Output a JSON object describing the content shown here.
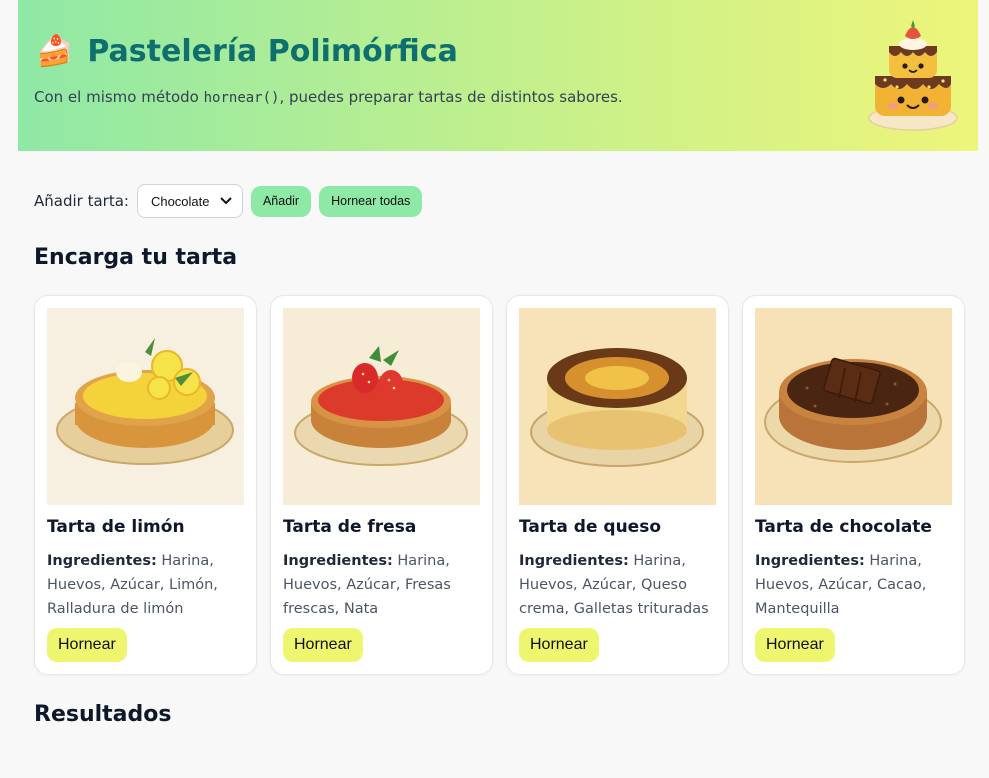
{
  "header": {
    "title": "Pastelería Polimórfica",
    "title_icon": "cake-icon",
    "subtitle_pre": "Con el mismo método ",
    "subtitle_code": "hornear()",
    "subtitle_post": ", puedes preparar tartas de distintos sabores.",
    "mascot_icon": "cake-mascot-icon"
  },
  "toolbar": {
    "add_label": "Añadir tarta:",
    "select_value": "Chocolate",
    "add_button": "Añadir",
    "bake_all_button": "Hornear todas"
  },
  "sections": {
    "order_title": "Encarga tu tarta",
    "results_title": "Resultados"
  },
  "cards": [
    {
      "title": "Tarta de limón",
      "ingredients_label": "Ingredientes:",
      "ingredients": "Harina, Huevos, Azúcar, Limón, Ralladura de limón",
      "button": "Hornear",
      "image": "lemon-tart-image"
    },
    {
      "title": "Tarta de fresa",
      "ingredients_label": "Ingredientes:",
      "ingredients": "Harina, Huevos, Azúcar, Fresas frescas, Nata",
      "button": "Hornear",
      "image": "strawberry-tart-image"
    },
    {
      "title": "Tarta de queso",
      "ingredients_label": "Ingredientes:",
      "ingredients": "Harina, Huevos, Azúcar, Queso crema, Galletas trituradas",
      "button": "Hornear",
      "image": "cheesecake-image"
    },
    {
      "title": "Tarta de chocolate",
      "ingredients_label": "Ingredientes:",
      "ingredients": "Harina, Huevos, Azúcar, Cacao, Mantequilla",
      "button": "Hornear",
      "image": "chocolate-tart-image"
    }
  ],
  "colors": {
    "header_gradient_start": "#8fe8a6",
    "header_gradient_end": "#eef57a",
    "title": "#0f6e6e",
    "green_button": "#8ee8a6",
    "yellow_button": "#eef56e"
  }
}
